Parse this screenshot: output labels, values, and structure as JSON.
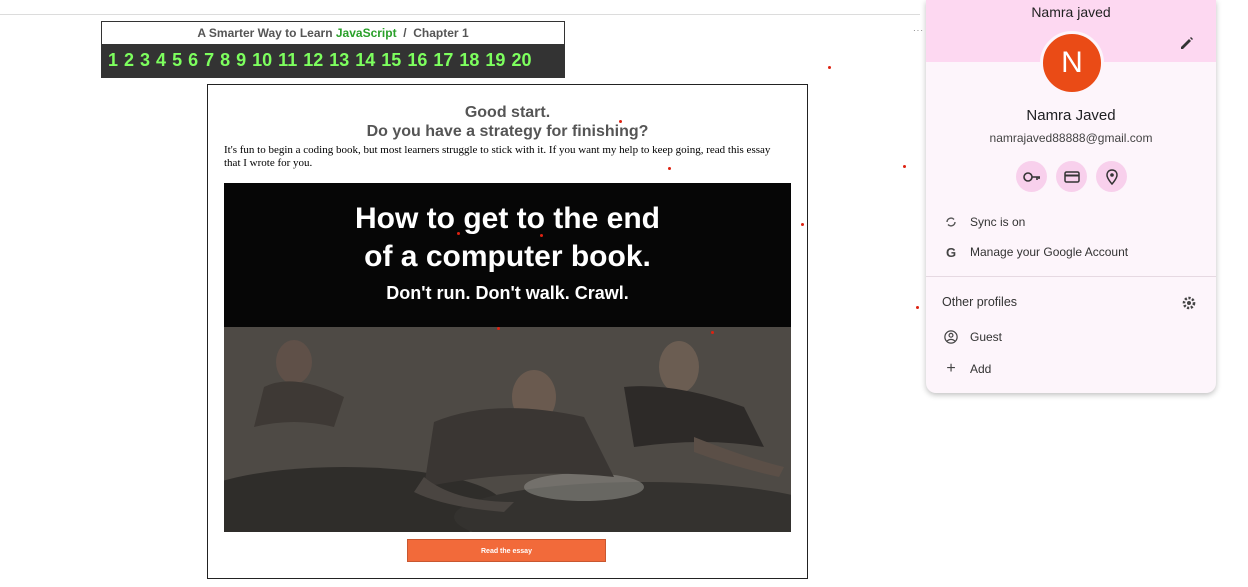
{
  "colors": {
    "js_green": "#2aa02a",
    "chapter_green": "#7dff5e",
    "nav_dark": "#333333",
    "button_orange": "#f26a3a",
    "avatar_orange": "#ea4b16",
    "profile_pink": "#fdd8f1"
  },
  "header": {
    "title_prefix": "A Smarter Way to Learn",
    "title_js": "JavaScript",
    "title_sep": "/",
    "title_chapter": "Chapter 1"
  },
  "chapters": [
    "1",
    "2",
    "3",
    "4",
    "5",
    "6",
    "7",
    "8",
    "9",
    "10",
    "11",
    "12",
    "13",
    "14",
    "15",
    "16",
    "17",
    "18",
    "19",
    "20"
  ],
  "card": {
    "heading_line1": "Good start.",
    "heading_line2": "Do you have a strategy for finishing?",
    "intro": "It's fun to begin a coding book, but most learners struggle to stick with it. If you want my help to keep going, read this essay that I wrote for you.",
    "banner_line1": "How to get to the end",
    "banner_line2": "of a computer book.",
    "banner_subtitle": "Don't run. Don't walk. Crawl.",
    "button_label": "Read the essay"
  },
  "profile": {
    "top_name": "Namra javed",
    "avatar_letter": "N",
    "full_name": "Namra Javed",
    "email": "namrajaved88888@gmail.com",
    "quick_icons": [
      "key-icon",
      "credit-card-icon",
      "location-pin-icon"
    ],
    "sync_label": "Sync is on",
    "manage_label": "Manage your Google Account",
    "other_profiles_title": "Other profiles",
    "guest_label": "Guest",
    "add_label": "Add"
  }
}
